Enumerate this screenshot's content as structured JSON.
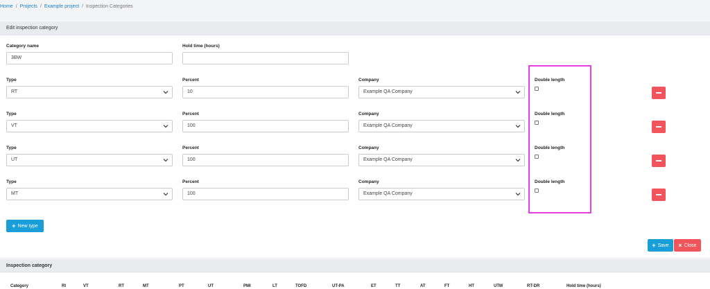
{
  "breadcrumb": {
    "home": "Home",
    "projects": "Projects",
    "project": "Example project",
    "current": "Inspection Categories",
    "separator": "/"
  },
  "edit_panel": {
    "title": "Edit inspection category",
    "category_name_label": "Category name",
    "category_name_value": "3BW",
    "hold_time_label": "Hold time (hours)",
    "hold_time_value": ""
  },
  "type_rows": [
    {
      "type_label": "Type",
      "type_value": "RT",
      "percent_label": "Percent",
      "percent_value": "10",
      "company_label": "Company",
      "company_value": "Example QA Company",
      "double_length_label": "Double length",
      "double_length_checked": false
    },
    {
      "type_label": "Type",
      "type_value": "VT",
      "percent_label": "Percent",
      "percent_value": "100",
      "company_label": "Company",
      "company_value": "Example QA Company",
      "double_length_label": "Double length",
      "double_length_checked": false
    },
    {
      "type_label": "Type",
      "type_value": "UT",
      "percent_label": "Percent",
      "percent_value": "100",
      "company_label": "Company",
      "company_value": "Example QA Company",
      "double_length_label": "Double length",
      "double_length_checked": false
    },
    {
      "type_label": "Type",
      "type_value": "MT",
      "percent_label": "Percent",
      "percent_value": "100",
      "company_label": "Company",
      "company_value": "Example QA Company",
      "double_length_label": "Double length",
      "double_length_checked": false
    }
  ],
  "buttons": {
    "new_type": "New type",
    "save": "Save",
    "close": "Close"
  },
  "list_panel": {
    "title": "Inspection category",
    "columns": [
      "Category",
      "RI",
      "VT",
      "RT",
      "MT",
      "PT",
      "UT",
      "PMI",
      "LT",
      "TOFD",
      "UT-PA",
      "ET",
      "TT",
      "AT",
      "FT",
      "HT",
      "UTM",
      "RT-DR",
      "Hold time (hours)"
    ]
  },
  "colors": {
    "accent": "#1a9ed8",
    "danger": "#f2545b",
    "highlight": "#e540e0",
    "link": "#1a7fc7"
  }
}
